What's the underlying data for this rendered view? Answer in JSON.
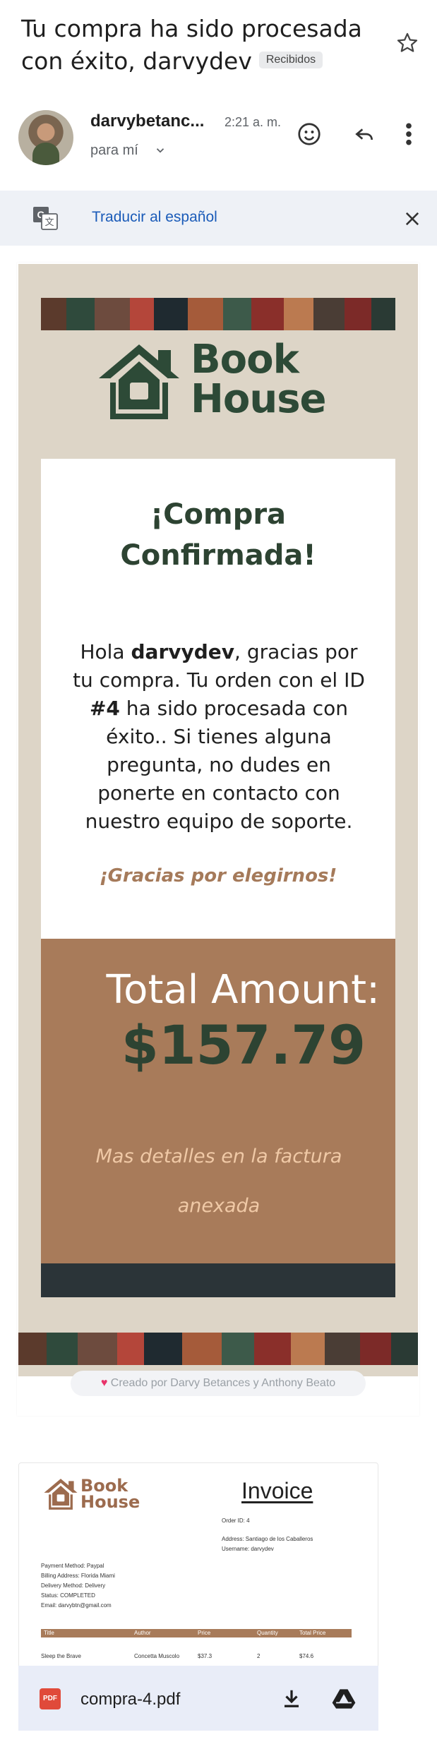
{
  "header": {
    "subject": "Tu compra ha sido procesada con éxito, darvydev",
    "label": "Recibidos",
    "star_icon": "star-icon"
  },
  "message": {
    "sender": "darvybetanc...",
    "time": "2:21 a. m.",
    "recipient": "para mí",
    "icons": [
      "emoji-icon",
      "reply-icon",
      "more-vert-icon"
    ]
  },
  "translate": {
    "text": "Traducir al español",
    "icon": "translate-icon",
    "close_icon": "close-icon"
  },
  "email": {
    "logo": {
      "line1": "Book",
      "line2": "House"
    },
    "title_line1": "¡Compra",
    "title_line2": "Confirmada!",
    "body_prefix": "Hola ",
    "username": "darvydev",
    "body_mid": ", gracias por tu compra. Tu orden con el ID ",
    "order_id": "#4",
    "body_suffix": " ha sido procesada con éxito.. Si tienes alguna pregunta, no dudes en ponerte en contacto con nuestro equipo de soporte.",
    "thanks": "¡Gracias por elegirnos!",
    "total_label": "Total Amount:",
    "total_value": "$157.79",
    "details_line1": "Mas detalles en la factura",
    "details_line2": "anexada",
    "created_by": "Creado por Darvy Betances y Anthony Beato",
    "colors": {
      "green": "#2d4332",
      "brown": "#a87b5a",
      "beige": "#ddd5c7",
      "dark": "#2b3438"
    }
  },
  "attachment": {
    "filename": "compra-4.pdf",
    "type_label": "PDF",
    "icons": [
      "pdf-icon",
      "download-icon",
      "drive-icon"
    ],
    "invoice": {
      "logo_line1": "Book",
      "logo_line2": "House",
      "title": "Invoice",
      "order_id": "Order ID: 4",
      "address": "Address: Santiago de los Caballeros",
      "username": "Username: darvydev",
      "payment_method": "Payment Method: Paypal",
      "billing_address": "Billing Address: Florida Miami",
      "delivery_method": "Delivery Method: Delivery",
      "status": "Status: COMPLETED",
      "email": "Email: darvybtn@gmail.com",
      "columns": [
        "Title",
        "Author",
        "Price",
        "Quantity",
        "Total Price"
      ],
      "row": [
        "Sleep the Brave",
        "Concetta Muscolo",
        "$37.3",
        "2",
        "$74.6"
      ]
    }
  }
}
